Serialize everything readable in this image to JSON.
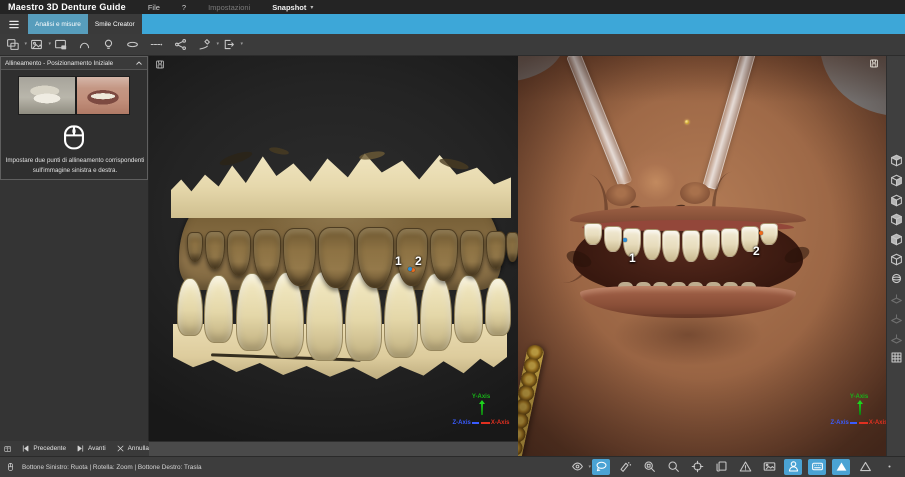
{
  "app": {
    "title": "Maestro 3D Denture Guide"
  },
  "menu": {
    "file": "File",
    "help": "?",
    "settings": "Impostazioni",
    "snapshot": "Snapshot"
  },
  "tabs": {
    "analysis": "Analisi e misure",
    "smile": "Smile Creator"
  },
  "toolbar_top": {
    "icons": [
      {
        "name": "image-layers-icon",
        "glyph": "image-layers",
        "caret": true
      },
      {
        "name": "image-frame-icon",
        "glyph": "image-frame",
        "caret": true
      },
      {
        "name": "screen-pin-icon",
        "glyph": "screen-pin"
      },
      {
        "name": "arc-tool-icon",
        "glyph": "arc-tool"
      },
      {
        "name": "bulb-icon",
        "glyph": "bulb"
      },
      {
        "name": "lips-ellipse-icon",
        "glyph": "lips-ellipse"
      },
      {
        "name": "dashed-line-icon",
        "glyph": "dashed-line"
      },
      {
        "name": "share-nodes-icon",
        "glyph": "share-nodes"
      },
      {
        "name": "draw-pen-icon",
        "glyph": "draw-pen",
        "caret": true
      },
      {
        "name": "export-icon",
        "glyph": "export",
        "caret": true
      }
    ]
  },
  "alignment_panel": {
    "title": "Allineamento - Posizionamento Iniziale",
    "instruction_line1": "Impostare due punti di allineamento corrispondenti",
    "instruction_line2": "sull'immagine sinistra e destra.",
    "thumbnails": [
      "model-scan-thumbnail",
      "mouth-photo-thumbnail"
    ]
  },
  "viewport_left": {
    "points": [
      {
        "label": "1",
        "color": "#ee6b1e"
      },
      {
        "label": "2",
        "color": "#2f8fd6"
      }
    ]
  },
  "viewport_right": {
    "points": [
      {
        "label": "1",
        "color": "#2f8fd6"
      },
      {
        "label": "2",
        "color": "#ee6b1e"
      }
    ]
  },
  "axis_gizmo": {
    "y": "Y-Axis",
    "x": "X-Axis",
    "z": "Z-Axis",
    "y_color": "#18b418",
    "x_color": "#e03020",
    "z_color": "#3a5cff"
  },
  "nav": {
    "previous": "Precedente",
    "next": "Avanti",
    "cancel": "Annulla"
  },
  "status": {
    "hint": "Bottone Sinistro: Ruota | Rotella: Zoom | Bottone Destro: Trasla"
  },
  "toolbar_bottom": {
    "icons": [
      {
        "name": "visibility-eye-icon",
        "glyph": "visibility-eye",
        "caret": true
      },
      {
        "name": "lasso-select-icon",
        "glyph": "lasso-select",
        "active": true
      },
      {
        "name": "brush-points-icon",
        "glyph": "brush-points"
      },
      {
        "name": "zoom-region-icon",
        "glyph": "zoom-region"
      },
      {
        "name": "zoom-icon",
        "glyph": "zoom"
      },
      {
        "name": "center-target-icon",
        "glyph": "center-target"
      },
      {
        "name": "copy-view-icon",
        "glyph": "copy-view"
      },
      {
        "name": "triangle-warning-icon",
        "glyph": "triangle-warning"
      },
      {
        "name": "screenshot-icon",
        "glyph": "screenshot"
      },
      {
        "name": "bust-icon",
        "glyph": "bust",
        "active": true
      },
      {
        "name": "texture-pad-icon",
        "glyph": "texture-pad",
        "active": true
      },
      {
        "name": "solid-triangle-icon",
        "glyph": "solid-triangle",
        "active": true
      },
      {
        "name": "wireframe-triangle-icon",
        "glyph": "wireframe-triangle"
      },
      {
        "name": "more-dot-icon",
        "glyph": "more-dot"
      }
    ]
  },
  "toolbar_right": {
    "icons": [
      {
        "name": "view-cube-top-icon",
        "glyph": "cube-top"
      },
      {
        "name": "view-cube-back-icon",
        "glyph": "cube-right"
      },
      {
        "name": "view-cube-left-icon",
        "glyph": "cube-left"
      },
      {
        "name": "view-cube-right-icon",
        "glyph": "cube-topright"
      },
      {
        "name": "view-cube-front-icon",
        "glyph": "cube-topleft"
      },
      {
        "name": "view-cube-bottom-icon",
        "glyph": "cube-plain"
      },
      {
        "name": "view-sphere-icon",
        "glyph": "sphere"
      },
      {
        "name": "plane-view-icon",
        "glyph": "plane",
        "disabled": true
      },
      {
        "name": "plane-view-icon",
        "glyph": "plane",
        "disabled": true
      },
      {
        "name": "plane-view-icon",
        "glyph": "plane",
        "disabled": true
      },
      {
        "name": "grid-views-icon",
        "glyph": "grid"
      }
    ]
  },
  "colors": {
    "accent_blue": "#3da7d8",
    "active_tool": "#4aa3d4",
    "model_tan": "#8a7044",
    "model_cream": "#e9ddb4",
    "skin": "#a06b4a"
  }
}
